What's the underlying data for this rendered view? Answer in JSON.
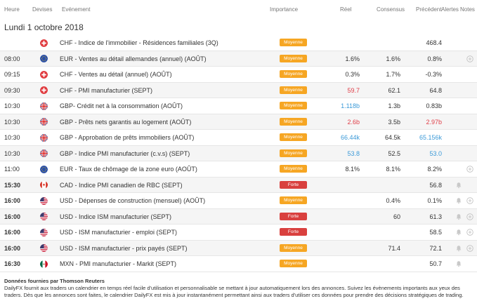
{
  "header": {
    "heure": "Heure",
    "devises": "Devises",
    "evenement": "Evénement",
    "importance": "Importance",
    "reel": "Réel",
    "consensus": "Consensus",
    "precedent": "Précédent",
    "alertes": "Alertes",
    "notes": "Notes"
  },
  "date_title": "Lundi 1 octobre 2018",
  "rows": [
    {
      "time": "",
      "flag": "ch",
      "event": "CHF - Indice de l'immobilier - Résidences familiales (3Q)",
      "importance": "Moyenne",
      "level": "moyenne",
      "reel": "",
      "reel_color": "",
      "consensus": "",
      "precedent": "468.4",
      "prec_color": "",
      "bell": false,
      "plus": false,
      "bold": false
    },
    {
      "time": "08:00",
      "flag": "eu",
      "event": "EUR - Ventes au détail allemandes (annuel) (AOÛT)",
      "importance": "Moyenne",
      "level": "moyenne",
      "reel": "1.6%",
      "reel_color": "",
      "consensus": "1.6%",
      "precedent": "0.8%",
      "prec_color": "",
      "bell": false,
      "plus": true,
      "bold": false
    },
    {
      "time": "09:15",
      "flag": "ch",
      "event": "CHF - Ventes au détail (annuel) (AOÛT)",
      "importance": "Moyenne",
      "level": "moyenne",
      "reel": "0.3%",
      "reel_color": "",
      "consensus": "1.7%",
      "precedent": "-0.3%",
      "prec_color": "",
      "bell": false,
      "plus": false,
      "bold": false
    },
    {
      "time": "09:30",
      "flag": "ch",
      "event": "CHF - PMI manufacturier (SEPT)",
      "importance": "Moyenne",
      "level": "moyenne",
      "reel": "59.7",
      "reel_color": "red",
      "consensus": "62.1",
      "precedent": "64.8",
      "prec_color": "",
      "bell": false,
      "plus": false,
      "bold": false
    },
    {
      "time": "10:30",
      "flag": "gb",
      "event": "GBP- Crédit net à la consommation (AOÛT)",
      "importance": "Moyenne",
      "level": "moyenne",
      "reel": "1.118b",
      "reel_color": "blue",
      "consensus": "1.3b",
      "precedent": "0.83b",
      "prec_color": "",
      "bell": false,
      "plus": false,
      "bold": false
    },
    {
      "time": "10:30",
      "flag": "gb",
      "event": "GBP - Prêts nets garantis au logement (AOÛT)",
      "importance": "Moyenne",
      "level": "moyenne",
      "reel": "2.6b",
      "reel_color": "red",
      "consensus": "3.5b",
      "precedent": "2.97b",
      "prec_color": "red",
      "bell": false,
      "plus": false,
      "bold": false
    },
    {
      "time": "10:30",
      "flag": "gb",
      "event": "GBP - Approbation de prêts immobiliers (AOÛT)",
      "importance": "Moyenne",
      "level": "moyenne",
      "reel": "66.44k",
      "reel_color": "blue",
      "consensus": "64.5k",
      "precedent": "65.156k",
      "prec_color": "blue",
      "bell": false,
      "plus": false,
      "bold": false
    },
    {
      "time": "10:30",
      "flag": "gb",
      "event": "GBP - Indice PMI manufacturier (c.v.s) (SEPT)",
      "importance": "Moyenne",
      "level": "moyenne",
      "reel": "53.8",
      "reel_color": "blue",
      "consensus": "52.5",
      "precedent": "53.0",
      "prec_color": "blue",
      "bell": false,
      "plus": false,
      "bold": false
    },
    {
      "time": "11:00",
      "flag": "eu",
      "event": "EUR - Taux de chômage de la zone euro (AOÛT)",
      "importance": "Moyenne",
      "level": "moyenne",
      "reel": "8.1%",
      "reel_color": "",
      "consensus": "8.1%",
      "precedent": "8.2%",
      "prec_color": "",
      "bell": false,
      "plus": true,
      "bold": false
    },
    {
      "time": "15:30",
      "flag": "ca",
      "event": "CAD - Indice PMI canadien de RBC (SEPT)",
      "importance": "Forte",
      "level": "forte",
      "reel": "",
      "reel_color": "",
      "consensus": "",
      "precedent": "56.8",
      "prec_color": "",
      "bell": true,
      "plus": false,
      "bold": true
    },
    {
      "time": "16:00",
      "flag": "us",
      "event": "USD - Dépenses de construction (mensuel) (AOÛT)",
      "importance": "Moyenne",
      "level": "moyenne",
      "reel": "",
      "reel_color": "",
      "consensus": "0.4%",
      "precedent": "0.1%",
      "prec_color": "",
      "bell": true,
      "plus": true,
      "bold": true
    },
    {
      "time": "16:00",
      "flag": "us",
      "event": "USD - Indice ISM manufacturier (SEPT)",
      "importance": "Forte",
      "level": "forte",
      "reel": "",
      "reel_color": "",
      "consensus": "60",
      "precedent": "61.3",
      "prec_color": "",
      "bell": true,
      "plus": true,
      "bold": true
    },
    {
      "time": "16:00",
      "flag": "us",
      "event": "USD - ISM manufacturier - emploi (SEPT)",
      "importance": "Forte",
      "level": "forte",
      "reel": "",
      "reel_color": "",
      "consensus": "",
      "precedent": "58.5",
      "prec_color": "",
      "bell": true,
      "plus": true,
      "bold": true
    },
    {
      "time": "16:00",
      "flag": "us",
      "event": "USD - ISM manufacturier - prix payés (SEPT)",
      "importance": "Moyenne",
      "level": "moyenne",
      "reel": "",
      "reel_color": "",
      "consensus": "71.4",
      "precedent": "72.1",
      "prec_color": "",
      "bell": true,
      "plus": true,
      "bold": true
    },
    {
      "time": "16:30",
      "flag": "mx",
      "event": "MXN - PMI manufacturier - Markit (SEPT)",
      "importance": "Moyenne",
      "level": "moyenne",
      "reel": "",
      "reel_color": "",
      "consensus": "",
      "precedent": "50.7",
      "prec_color": "",
      "bell": true,
      "plus": false,
      "bold": true
    }
  ],
  "footer": {
    "source": "Données fournies par Thomson Reuters",
    "description": "DailyFX fournit aux traders un calendrier en temps réel facile d'utilisation et personnalisable se mettant à jour automatiquement lors des annonces. Suivez les évènements importants aux yeux des traders. Dès que les annonces sont faites, le calendrier DailyFX est mis à jour instantanément permettant ainsi aux traders d'utiliser ces données pour prendre des décisions stratégiques de trading."
  },
  "colors": {
    "moyenne": "#f6a623",
    "forte": "#d9403e",
    "positive": "#3c9ad8",
    "negative": "#e0404a"
  }
}
